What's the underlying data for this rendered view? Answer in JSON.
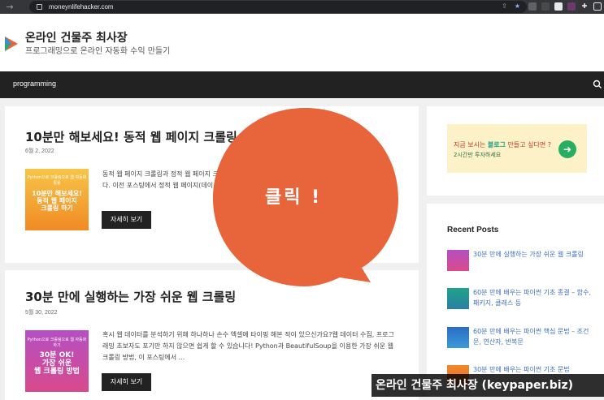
{
  "browser": {
    "url": "moneynlifehacker.com",
    "nav_glyph": "→"
  },
  "header": {
    "site_title": "온라인 건물주 최사장",
    "site_description": "프로그래밍으로 온라인 자동화 수익 만들기"
  },
  "navbar": {
    "item": "programming"
  },
  "posts": [
    {
      "title": "10분만 해보세요! 동적 웹 페이지 크롤링 (Se",
      "date": "6월 2, 2022",
      "thumb_tiny": "Python으로 크롤링으로 웹 자동화 활용",
      "thumb_big": "10분만 해보세요!\n동적 웹 페이지\n크롤링 하기",
      "excerpt": "동적 웹 페이지 크롤링과 정적 웹 페이지 크 ...는 동적 웹 페이지의 데이터를 크롤링 하는 방법에 ... 에 보았다. 이전 포스팅에서 정적 웹 페이지(데이",
      "button": "자세히 보기"
    },
    {
      "title": "30분 만에 실행하는 가장 쉬운 웹 크롤링",
      "date": "5월 30, 2022",
      "thumb_tiny": "Python으로 크롤링으로 웹 자동화 하기",
      "thumb_big": "30분 OK!\n가장 쉬운\n웹 크롤링 방법",
      "excerpt": "혹시 웹 데이터를 분석하기 위해 하나하나 손수 엑셀에 타이핑 해본 적이 있으신가요?웹 데이터 수집, 프로그래밍 초보자도 포기만 하지 않으면 쉽게 할 수 있습니다! Python과 BeautifulSoup을 이용한 가장 쉬운 웹 크롤링 방법, 이 포스팅에서 ...",
      "button": "자세히 보기"
    }
  ],
  "sidebar": {
    "banner_line1_a": "지금 보시는 ",
    "banner_line1_b": "블로그",
    "banner_line1_c": " 만들고 싶다면 ?",
    "banner_line2": "2시간만 투자하세요",
    "banner_arrow": "➜",
    "recent_title": "Recent Posts",
    "recent_posts": [
      "30분 만에 실행하는 가장 쉬운 웹 크롤링",
      "60분 만에 배우는 파이썬 기초 종결 – 함수, 패키지, 클래스 등",
      "60분 만에 배우는 파이썬 핵심 문법 – 조건문, 연산자, 반복문",
      "30분 만에 배우는 파이썬 기초 문법"
    ]
  },
  "overlay": {
    "bubble_text": "클릭 !",
    "watermark": "온라인 건물주 최사장 (keypaper.biz)"
  },
  "colors": {
    "bubble": "#e8643a",
    "navbar": "#222222",
    "link": "#3c6ec6"
  }
}
